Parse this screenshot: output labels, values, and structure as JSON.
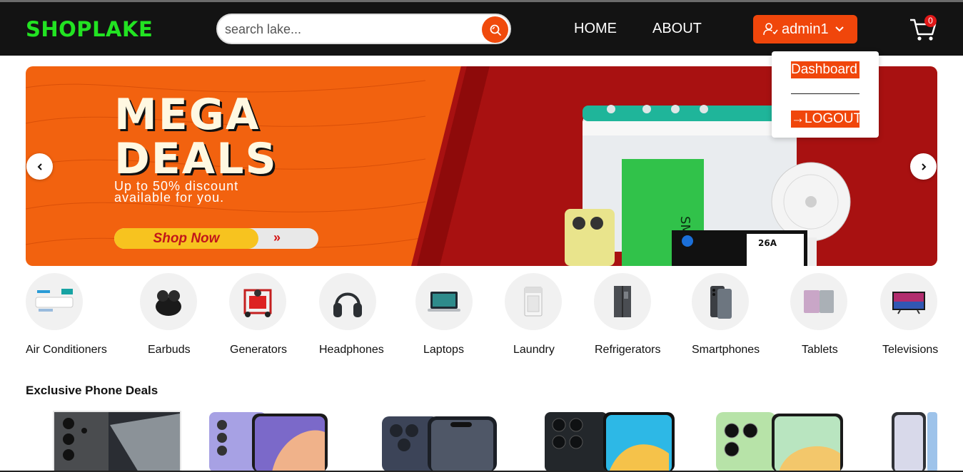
{
  "header": {
    "logo": "SHOPLAKE",
    "search_placeholder": "search lake...",
    "nav": [
      {
        "label": "HOME"
      },
      {
        "label": "ABOUT"
      }
    ],
    "user": {
      "name": "admin1"
    },
    "cart_count": "0"
  },
  "user_menu": {
    "dashboard": "Dashboard",
    "logout": "LOGOUT"
  },
  "banner": {
    "headline_1": "MEGA",
    "headline_2": "DEALS",
    "subtitle_1": "Up to 50% discount",
    "subtitle_2": "available for you.",
    "cta": "Shop Now",
    "cta_arrows": "»"
  },
  "categories": [
    {
      "label": "Air Conditioners"
    },
    {
      "label": "Earbuds"
    },
    {
      "label": "Generators"
    },
    {
      "label": "Headphones"
    },
    {
      "label": "Laptops"
    },
    {
      "label": "Laundry"
    },
    {
      "label": "Refrigerators"
    },
    {
      "label": "Smartphones"
    },
    {
      "label": "Tablets"
    },
    {
      "label": "Televisions"
    }
  ],
  "deals": {
    "title": "Exclusive Phone Deals"
  },
  "colors": {
    "accent": "#f0460b",
    "logo": "#22e322",
    "header_bg": "#131313"
  }
}
